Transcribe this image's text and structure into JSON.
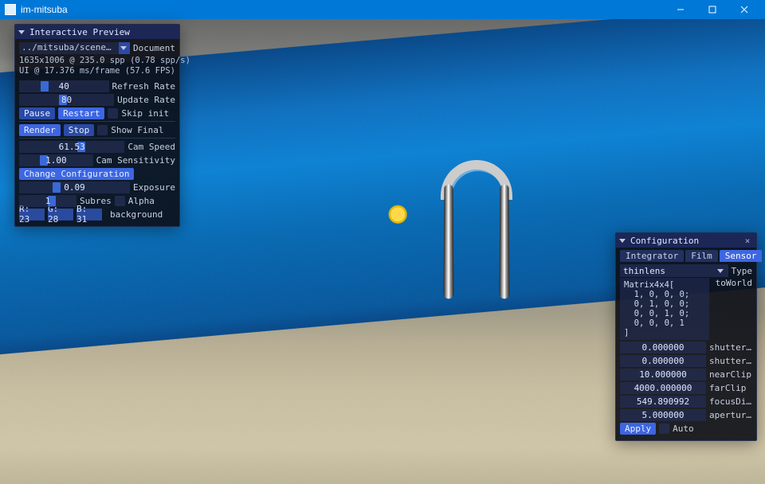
{
  "window": {
    "title": "im-mitsuba"
  },
  "preview": {
    "title": "Interactive Preview",
    "scene_path": "../mitsuba/scenes/pool/poo",
    "document_label": "Document",
    "stats_line1": "1635x1006 @ 235.0 spp (0.78 spp/s)",
    "stats_line2": "UI @ 17.376 ms/frame (57.6 FPS)",
    "refresh_rate": {
      "value": "40",
      "label": "Refresh Rate",
      "grab_pct": 24
    },
    "update_rate": {
      "value": "80",
      "label": "Update Rate",
      "grab_pct": 42
    },
    "pause_label": "Pause",
    "restart_label": "Restart",
    "skip_init_label": "Skip init",
    "render_label": "Render",
    "stop_label": "Stop",
    "show_final_label": "Show Final",
    "cam_speed": {
      "value": "61.53",
      "label": "Cam Speed",
      "grab_pct": 55
    },
    "cam_sensitivity": {
      "value": "1.00",
      "label": "Cam Sensitivity",
      "grab_pct": 28
    },
    "change_config_label": "Change Configuration",
    "exposure": {
      "value": "0.09",
      "label": "Exposure",
      "grab_pct": 30
    },
    "subres": {
      "value": "1",
      "label": "Subres",
      "grab_pct": 50
    },
    "alpha_label": "Alpha",
    "bg": {
      "r": "R: 23",
      "g": "G: 28",
      "b": "B: 31",
      "label": "background"
    }
  },
  "config": {
    "title": "Configuration",
    "tabs": {
      "integrator": "Integrator",
      "film": "Film",
      "sensor": "Sensor"
    },
    "active_tab": "sensor",
    "type_value": "thinlens",
    "type_label": "Type",
    "toWorld_label": "toWorld",
    "toWorld_matrix": "Matrix4x4[\n  1, 0, 0, 0;\n  0, 1, 0, 0;\n  0, 0, 1, 0;\n  0, 0, 0, 1\n]",
    "params": [
      {
        "value": "0.000000",
        "label": "shutterOpen"
      },
      {
        "value": "0.000000",
        "label": "shutterClose"
      },
      {
        "value": "10.000000",
        "label": "nearClip"
      },
      {
        "value": "4000.000000",
        "label": "farClip"
      },
      {
        "value": "549.890992",
        "label": "focusDistance"
      },
      {
        "value": "5.000000",
        "label": "apertureRadius"
      }
    ],
    "apply_label": "Apply",
    "auto_label": "Auto"
  }
}
